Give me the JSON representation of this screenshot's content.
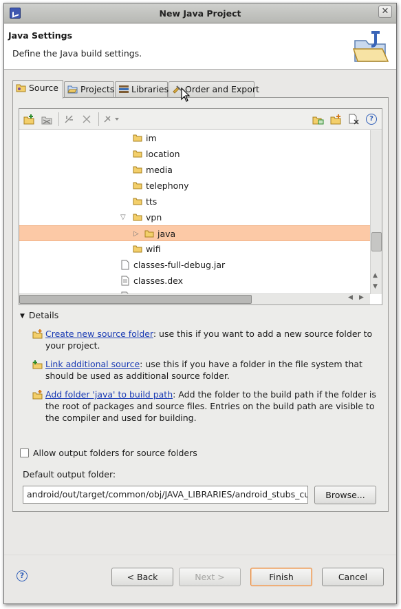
{
  "window": {
    "title": "New Java Project"
  },
  "header": {
    "title": "Java Settings",
    "subtitle": "Define the Java build settings."
  },
  "tabs": [
    {
      "label": "Source",
      "active": true
    },
    {
      "label": "Projects",
      "active": false
    },
    {
      "label": "Libraries",
      "active": false
    },
    {
      "label": "Order and Export",
      "active": false
    }
  ],
  "toolbar_icons": [
    "add-source-folder-icon",
    "remove-source-folder-icon",
    "link-source-icon",
    "remove-link-icon",
    "configure-dropdown-icon",
    "new-folder-icon",
    "add-folder-icon",
    "remove-icon",
    "help-icon"
  ],
  "tree": {
    "items": [
      {
        "label": "im",
        "type": "folder"
      },
      {
        "label": "location",
        "type": "folder"
      },
      {
        "label": "media",
        "type": "folder"
      },
      {
        "label": "telephony",
        "type": "folder"
      },
      {
        "label": "tts",
        "type": "folder"
      },
      {
        "label": "vpn",
        "type": "folder",
        "expanded": true
      },
      {
        "label": "java",
        "type": "folder",
        "selected": true
      },
      {
        "label": "wifi",
        "type": "folder"
      },
      {
        "label": "classes-full-debug.jar",
        "type": "file"
      },
      {
        "label": "classes.dex",
        "type": "file"
      }
    ]
  },
  "details": {
    "toggle_label": "Details",
    "items": [
      {
        "link": "Create new source folder",
        "text": ": use this if you want to add a new source folder to your project."
      },
      {
        "link": "Link additional source",
        "text": ": use this if you have a folder in the file system that should be used as additional source folder."
      },
      {
        "link": "Add folder 'java' to build path",
        "text": ": Add the folder to the build path if the folder is the root of packages and source files. Entries on the build path are visible to the compiler and used for building."
      }
    ]
  },
  "output": {
    "allow_label": "Allow output folders for source folders",
    "allow_checked": false,
    "default_label": "Default output folder:",
    "default_value": "android/out/target/common/obj/JAVA_LIBRARIES/android_stubs_curre",
    "browse_label": "Browse..."
  },
  "buttons": {
    "back": "< Back",
    "next": "Next >",
    "finish": "Finish",
    "cancel": "Cancel"
  },
  "colors": {
    "selection": "#fcc9a6",
    "link": "#1a3bb4",
    "default_button_border": "#e58a3f"
  }
}
